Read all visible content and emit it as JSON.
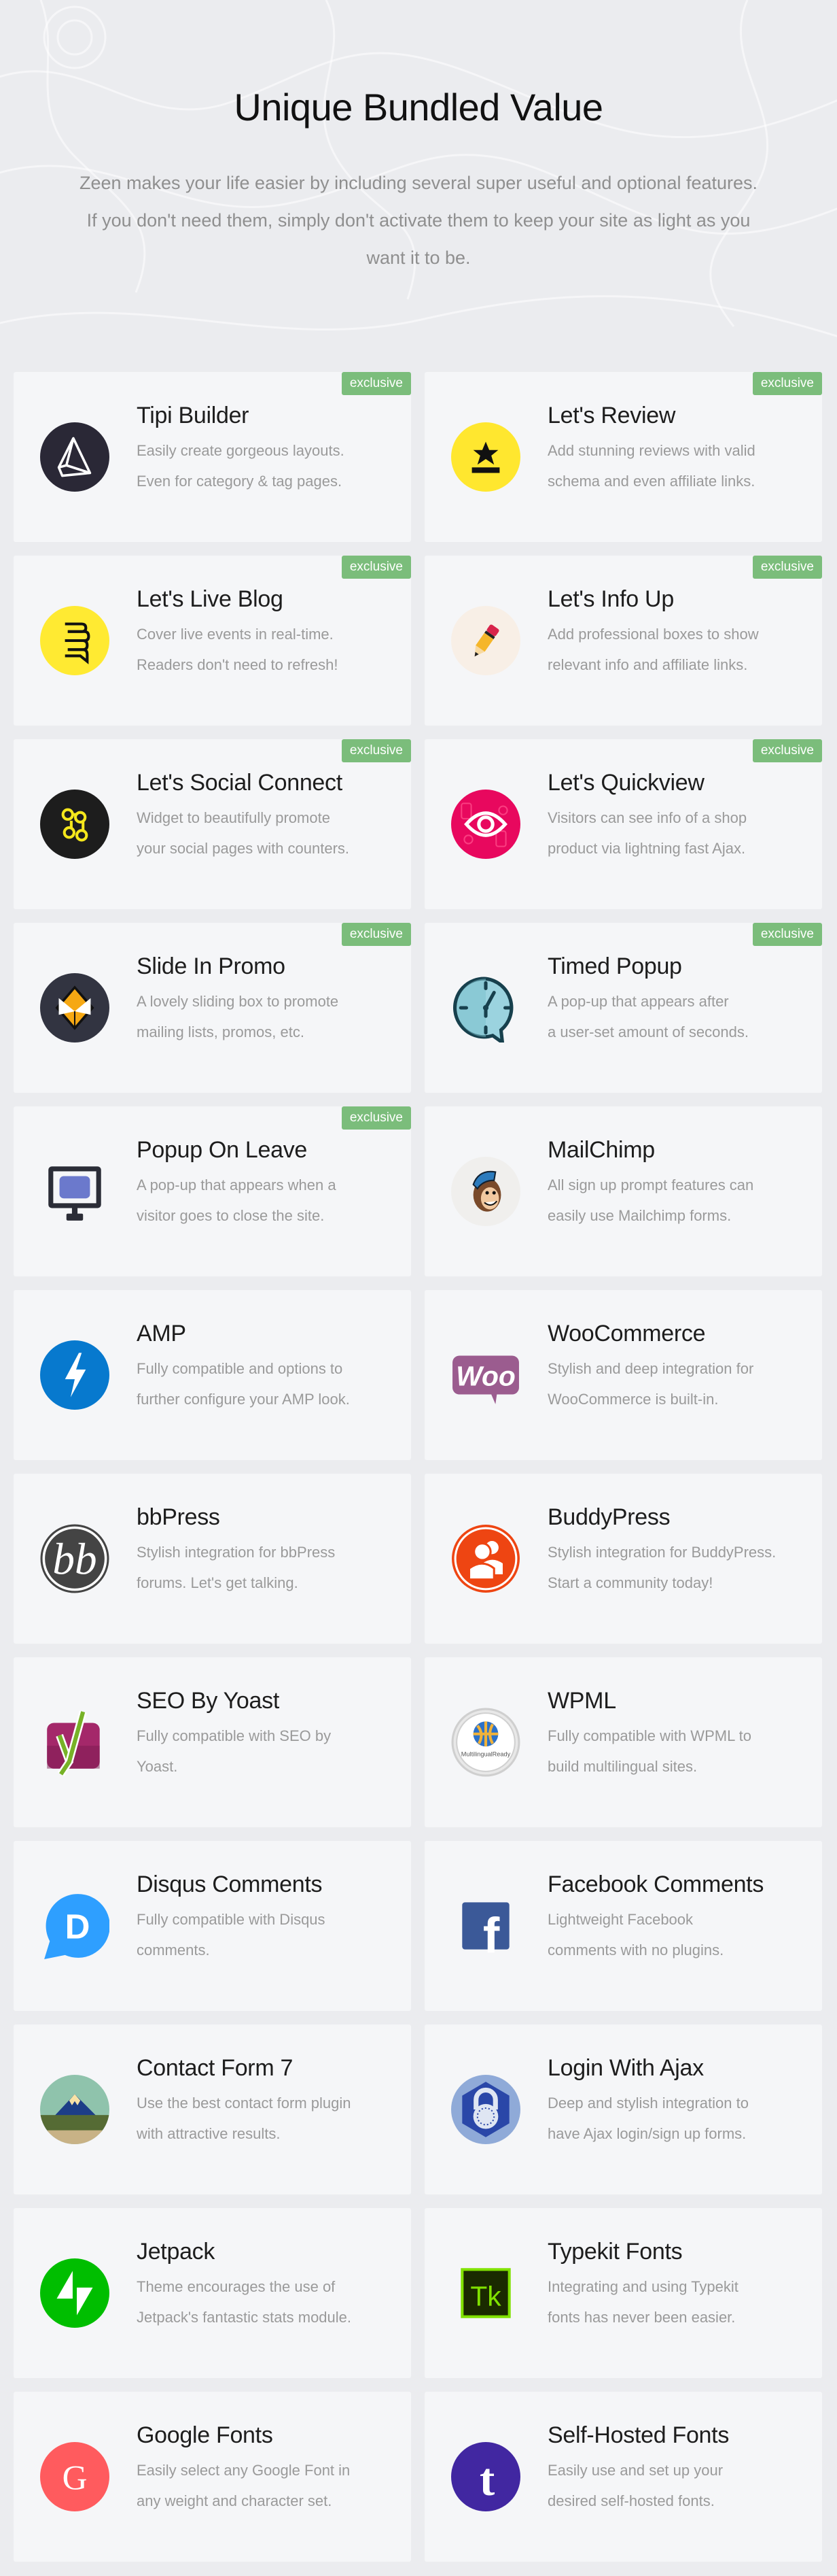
{
  "header": {
    "title": "Unique Bundled Value",
    "subtitle": "Zeen makes your life easier by including several super useful and optional features. If you don't need them, simply don't activate them to keep your site as light as you want it to be."
  },
  "badge_color": "#7bbd7b",
  "features": [
    {
      "name": "Tipi Builder",
      "desc": [
        "Easily create gorgeous layouts.",
        "Even for category & tag pages."
      ],
      "badge": "exclusive",
      "icon": "tipi-builder-icon"
    },
    {
      "name": "Let's Review",
      "desc": [
        "Add stunning reviews with valid",
        "schema and even affiliate links."
      ],
      "badge": "exclusive",
      "icon": "lets-review-icon"
    },
    {
      "name": "Let's Live Blog",
      "desc": [
        "Cover live events in real-time.",
        "Readers don't need to refresh!"
      ],
      "badge": "exclusive",
      "icon": "live-blog-icon"
    },
    {
      "name": "Let's Info Up",
      "desc": [
        "Add professional boxes to show",
        "relevant info and affiliate links."
      ],
      "badge": "exclusive",
      "icon": "info-up-icon"
    },
    {
      "name": "Let's Social Connect",
      "desc": [
        "Widget to beautifully promote",
        "your social pages with counters."
      ],
      "badge": "exclusive",
      "icon": "social-connect-icon"
    },
    {
      "name": "Let's Quickview",
      "desc": [
        "Visitors can see info of a shop",
        "product via lightning fast Ajax."
      ],
      "badge": "exclusive",
      "icon": "quickview-icon"
    },
    {
      "name": "Slide In Promo",
      "desc": [
        "A lovely sliding box to promote",
        "mailing lists, promos, etc."
      ],
      "badge": "exclusive",
      "icon": "slide-in-promo-icon"
    },
    {
      "name": "Timed Popup",
      "desc": [
        "A pop-up that appears after",
        "a user-set amount of seconds."
      ],
      "badge": "exclusive",
      "icon": "timed-popup-icon"
    },
    {
      "name": "Popup On Leave",
      "desc": [
        "A pop-up that appears when a",
        "visitor goes to close the site."
      ],
      "badge": "exclusive",
      "icon": "popup-on-leave-icon"
    },
    {
      "name": "MailChimp",
      "desc": [
        "All sign up prompt features can",
        "easily use Mailchimp forms."
      ],
      "badge": null,
      "icon": "mailchimp-icon"
    },
    {
      "name": "AMP",
      "desc": [
        "Fully compatible and options to",
        "further configure your AMP look."
      ],
      "badge": null,
      "icon": "amp-icon"
    },
    {
      "name": "WooCommerce",
      "desc": [
        "Stylish and deep integration for",
        "WooCommerce is built-in."
      ],
      "badge": null,
      "icon": "woocommerce-icon"
    },
    {
      "name": "bbPress",
      "desc": [
        "Stylish integration for bbPress",
        "forums. Let's get talking."
      ],
      "badge": null,
      "icon": "bbpress-icon"
    },
    {
      "name": "BuddyPress",
      "desc": [
        "Stylish integration for BuddyPress.",
        "Start a community today!"
      ],
      "badge": null,
      "icon": "buddypress-icon"
    },
    {
      "name": "SEO By Yoast",
      "desc": [
        "Fully compatible with SEO by",
        "Yoast."
      ],
      "badge": null,
      "icon": "yoast-icon"
    },
    {
      "name": "WPML",
      "desc": [
        "Fully compatible with WPML to",
        "build multilingual sites."
      ],
      "badge": null,
      "icon": "wpml-icon",
      "icon_text": "MultilingualReady"
    },
    {
      "name": "Disqus Comments",
      "desc": [
        "Fully compatible with Disqus",
        "comments."
      ],
      "badge": null,
      "icon": "disqus-icon",
      "icon_text": "D"
    },
    {
      "name": "Facebook Comments",
      "desc": [
        "Lightweight Facebook",
        "comments with no plugins."
      ],
      "badge": null,
      "icon": "facebook-icon",
      "icon_text": "f"
    },
    {
      "name": "Contact Form 7",
      "desc": [
        "Use the best contact form plugin",
        "with attractive results."
      ],
      "badge": null,
      "icon": "contact-form-7-icon"
    },
    {
      "name": "Login With Ajax",
      "desc": [
        "Deep and stylish integration to",
        "have Ajax login/sign up forms."
      ],
      "badge": null,
      "icon": "login-with-ajax-icon"
    },
    {
      "name": "Jetpack",
      "desc": [
        "Theme encourages the use of",
        "Jetpack's fantastic stats module."
      ],
      "badge": null,
      "icon": "jetpack-icon"
    },
    {
      "name": "Typekit Fonts",
      "desc": [
        "Integrating and using Typekit",
        "fonts has never been easier."
      ],
      "badge": null,
      "icon": "typekit-icon",
      "icon_text": "Tk"
    },
    {
      "name": "Google Fonts",
      "desc": [
        "Easily select any Google Font in",
        "any weight and character set."
      ],
      "badge": null,
      "icon": "google-fonts-icon",
      "icon_text": "G"
    },
    {
      "name": "Self-Hosted Fonts",
      "desc": [
        "Easily use and set up your",
        "desired self-hosted fonts."
      ],
      "badge": null,
      "icon": "self-hosted-fonts-icon",
      "icon_text": "t"
    }
  ]
}
